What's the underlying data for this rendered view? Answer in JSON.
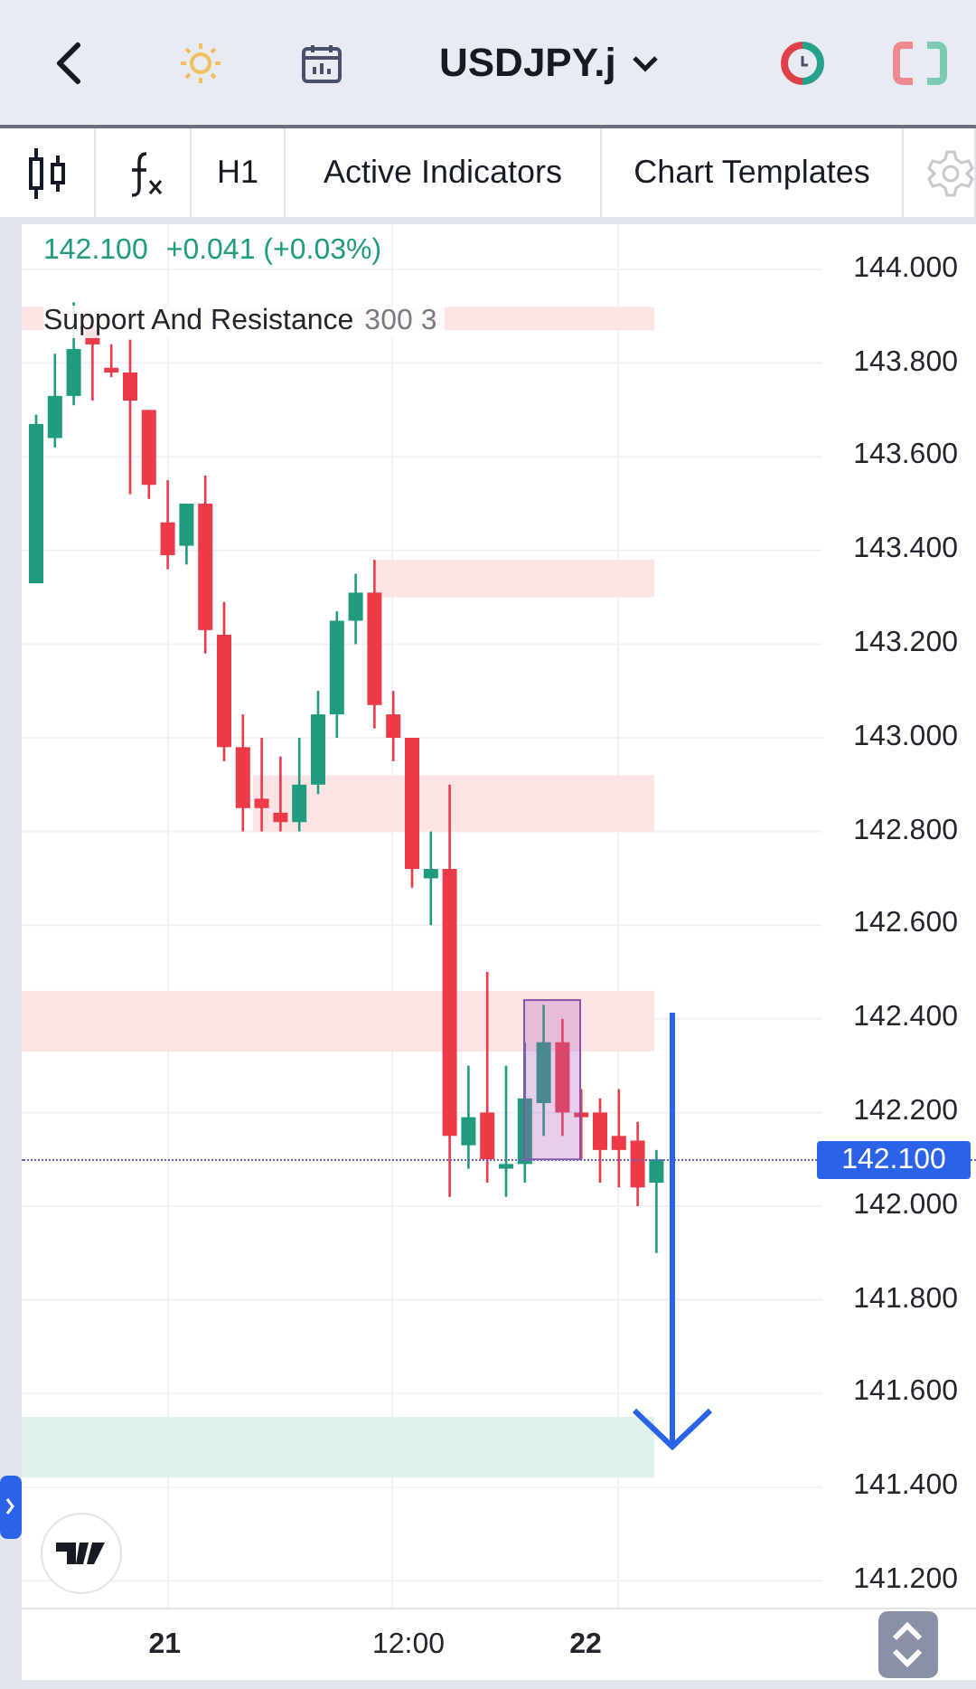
{
  "header": {
    "symbol": "USDJPY.j"
  },
  "toolbar": {
    "timeframe": "H1",
    "buttons": [
      "Active Indicators",
      "Chart Templates"
    ]
  },
  "legend": {
    "price": "142.100",
    "change": "+0.041 (+0.03%)",
    "indicator": "Support And Resistance",
    "indicator_params": "300 3"
  },
  "price_axis": [
    "144.000",
    "143.800",
    "143.600",
    "143.400",
    "143.200",
    "143.000",
    "142.800",
    "142.600",
    "142.400",
    "142.200",
    "142.000",
    "141.800",
    "141.600",
    "141.400",
    "141.200"
  ],
  "current_price": "142.100",
  "time_axis": [
    {
      "label": "21",
      "bold": true
    },
    {
      "label": "12:00",
      "bold": false
    },
    {
      "label": "22",
      "bold": true
    }
  ]
}
